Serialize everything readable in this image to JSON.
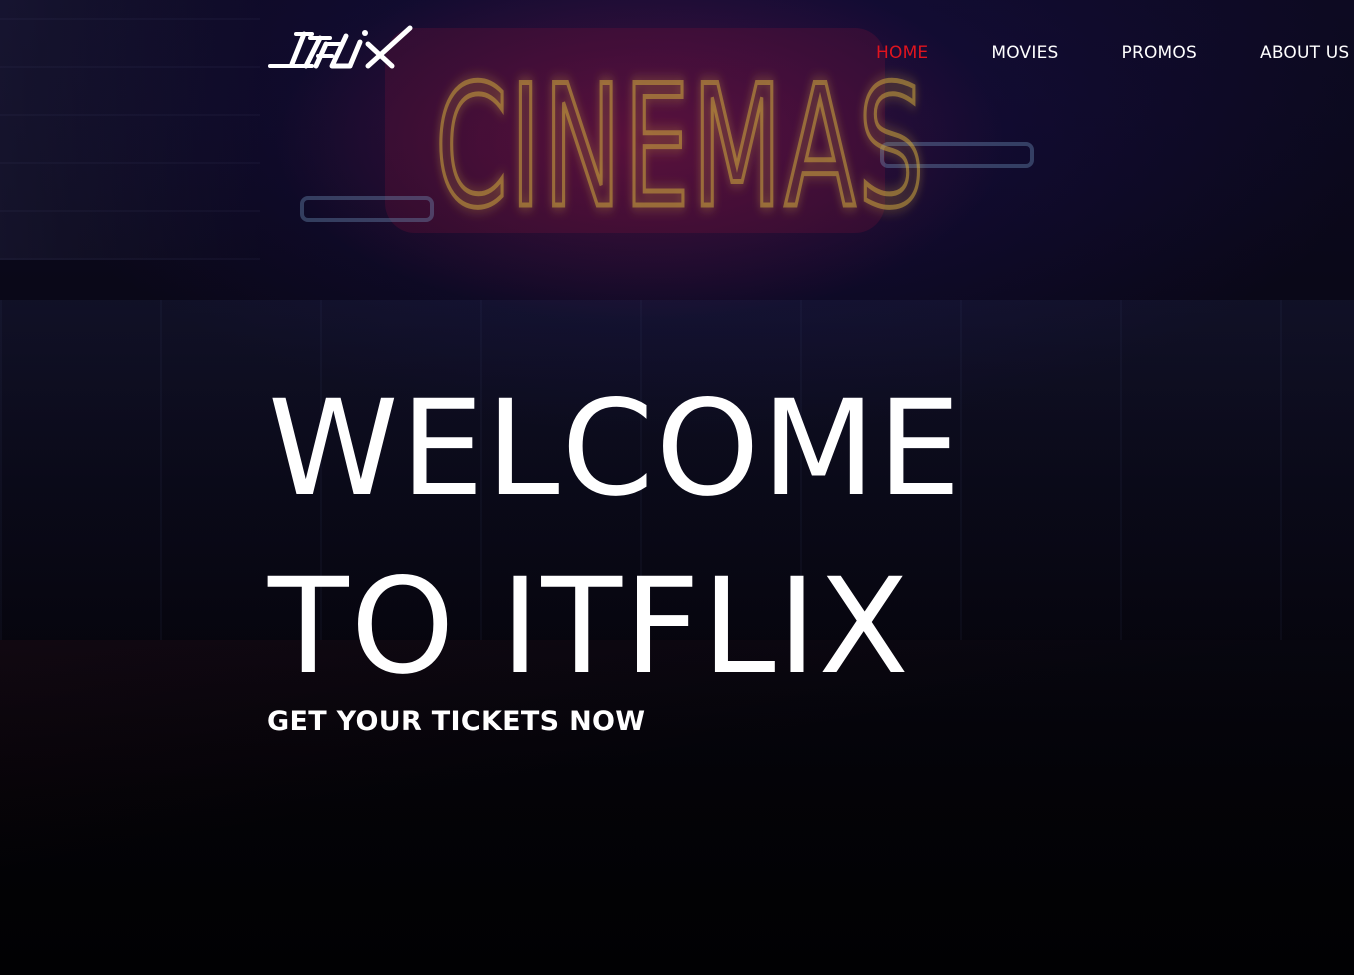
{
  "brand": {
    "logo_text": "ITFLIX",
    "logo_color": "#ffffff"
  },
  "background": {
    "sign_text": "CINEMAS",
    "sign_color": "#c9a23a",
    "sign_glow": "#b0143a"
  },
  "nav": {
    "items": [
      {
        "label": "HOME",
        "active": true
      },
      {
        "label": "MOVIES",
        "active": false
      },
      {
        "label": "PROMOS",
        "active": false
      },
      {
        "label": "ABOUT US",
        "active": false
      }
    ],
    "active_color": "#e0141e",
    "color": "#ffffff"
  },
  "hero": {
    "title_line1": "WELCOME",
    "title_line2": "TO ITFLIX",
    "subtitle": "GET YOUR TICKETS NOW"
  }
}
